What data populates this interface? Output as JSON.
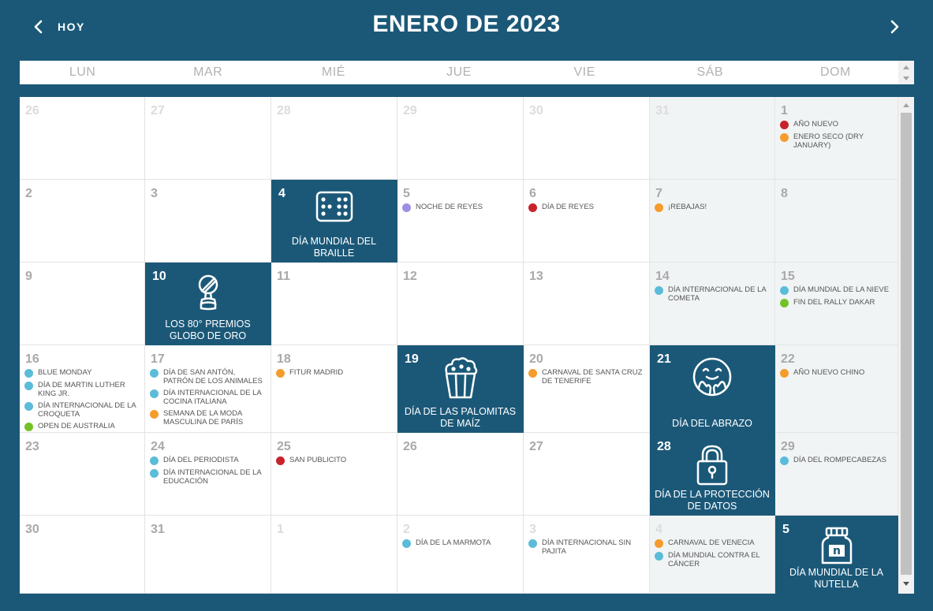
{
  "header": {
    "today_label": "HOY",
    "title": "ENERO DE 2023"
  },
  "weekdays": [
    "LUN",
    "MAR",
    "MIÉ",
    "JUE",
    "VIE",
    "SÁB",
    "DOM"
  ],
  "colors": {
    "red": "#c8222c",
    "orange": "#f59c2c",
    "blue": "#5bbcd9",
    "purple": "#a08ee3",
    "green": "#74c229",
    "navy": "#1b5878"
  },
  "weeks": [
    [
      {
        "day": "26",
        "other": true,
        "events": []
      },
      {
        "day": "27",
        "other": true,
        "events": []
      },
      {
        "day": "28",
        "other": true,
        "events": []
      },
      {
        "day": "29",
        "other": true,
        "events": []
      },
      {
        "day": "30",
        "other": true,
        "events": []
      },
      {
        "day": "31",
        "other": true,
        "weekend": true,
        "events": []
      },
      {
        "day": "1",
        "weekend": true,
        "events": [
          {
            "label": "AÑO NUEVO",
            "color": "red"
          },
          {
            "label": "ENERO SECO (DRY JANUARY)",
            "color": "orange"
          }
        ]
      }
    ],
    [
      {
        "day": "2",
        "events": []
      },
      {
        "day": "3",
        "events": []
      },
      {
        "day": "4",
        "featured": {
          "title": "DÍA MUNDIAL DEL BRAILLE",
          "icon": "braille-icon"
        }
      },
      {
        "day": "5",
        "events": [
          {
            "label": "NOCHE DE REYES",
            "color": "purple"
          }
        ]
      },
      {
        "day": "6",
        "events": [
          {
            "label": "DÍA DE REYES",
            "color": "red"
          }
        ]
      },
      {
        "day": "7",
        "weekend": true,
        "events": [
          {
            "label": "¡REBAJAS!",
            "color": "orange"
          }
        ]
      },
      {
        "day": "8",
        "weekend": true,
        "events": []
      }
    ],
    [
      {
        "day": "9",
        "events": []
      },
      {
        "day": "10",
        "featured": {
          "title": "LOS 80° PREMIOS GLOBO DE ORO",
          "icon": "golden-globe-icon"
        }
      },
      {
        "day": "11",
        "events": []
      },
      {
        "day": "12",
        "events": []
      },
      {
        "day": "13",
        "events": []
      },
      {
        "day": "14",
        "weekend": true,
        "events": [
          {
            "label": "DÍA INTERNACIONAL DE LA COMETA",
            "color": "blue"
          }
        ]
      },
      {
        "day": "15",
        "weekend": true,
        "events": [
          {
            "label": "DÍA MUNDIAL DE LA NIEVE",
            "color": "blue"
          },
          {
            "label": "FIN DEL RALLY DAKAR",
            "color": "green"
          }
        ]
      }
    ],
    [
      {
        "day": "16",
        "events": [
          {
            "label": "BLUE MONDAY",
            "color": "blue"
          },
          {
            "label": "DÍA DE MARTIN LUTHER KING JR.",
            "color": "blue"
          },
          {
            "label": "DÍA INTERNACIONAL DE LA CROQUETA",
            "color": "blue"
          },
          {
            "label": "OPEN DE AUSTRALIA",
            "color": "green"
          }
        ]
      },
      {
        "day": "17",
        "events": [
          {
            "label": "DÍA DE SAN ANTÓN, PATRÓN DE LOS ANIMALES",
            "color": "blue"
          },
          {
            "label": "DÍA INTERNACIONAL DE LA COCINA ITALIANA",
            "color": "blue"
          },
          {
            "label": "SEMANA DE LA MODA MASCULINA DE PARÍS",
            "color": "orange"
          }
        ]
      },
      {
        "day": "18",
        "events": [
          {
            "label": "FITUR MADRID",
            "color": "orange"
          }
        ]
      },
      {
        "day": "19",
        "featured": {
          "title": "DÍA DE LAS PALOMITAS DE MAÍZ",
          "icon": "popcorn-icon"
        }
      },
      {
        "day": "20",
        "events": [
          {
            "label": "CARNAVAL DE SANTA CRUZ DE TENERIFE",
            "color": "orange"
          }
        ]
      },
      {
        "day": "21",
        "featured": {
          "title": "DÍA DEL ABRAZO",
          "icon": "hug-icon"
        }
      },
      {
        "day": "22",
        "weekend": true,
        "events": [
          {
            "label": "AÑO NUEVO CHINO",
            "color": "orange"
          }
        ]
      }
    ],
    [
      {
        "day": "23",
        "events": []
      },
      {
        "day": "24",
        "events": [
          {
            "label": "DÍA DEL PERIODISTA",
            "color": "blue"
          },
          {
            "label": "DÍA INTERNACIONAL DE LA EDUCACIÓN",
            "color": "blue"
          }
        ]
      },
      {
        "day": "25",
        "events": [
          {
            "label": "SAN PUBLICITO",
            "color": "red"
          }
        ]
      },
      {
        "day": "26",
        "events": []
      },
      {
        "day": "27",
        "events": []
      },
      {
        "day": "28",
        "featured": {
          "title": "DÍA DE LA PROTECCIÓN DE DATOS",
          "icon": "padlock-icon"
        }
      },
      {
        "day": "29",
        "weekend": true,
        "events": [
          {
            "label": "DÍA DEL ROMPECABEZAS",
            "color": "blue"
          }
        ]
      }
    ],
    [
      {
        "day": "30",
        "events": []
      },
      {
        "day": "31",
        "events": []
      },
      {
        "day": "1",
        "other": true,
        "events": []
      },
      {
        "day": "2",
        "other": true,
        "events": [
          {
            "label": "DÍA DE LA MARMOTA",
            "color": "blue"
          }
        ]
      },
      {
        "day": "3",
        "other": true,
        "events": [
          {
            "label": "DÍA INTERNACIONAL SIN PAJITA",
            "color": "blue"
          }
        ]
      },
      {
        "day": "4",
        "other": true,
        "weekend": true,
        "events": [
          {
            "label": "CARNAVAL DE VENECIA",
            "color": "orange"
          },
          {
            "label": "DÍA MUNDIAL CONTRA EL CÁNCER",
            "color": "blue"
          }
        ]
      },
      {
        "day": "5",
        "other": true,
        "featured": {
          "title": "DÍA MUNDIAL DE LA NUTELLA",
          "icon": "nutella-jar-icon"
        }
      }
    ]
  ]
}
